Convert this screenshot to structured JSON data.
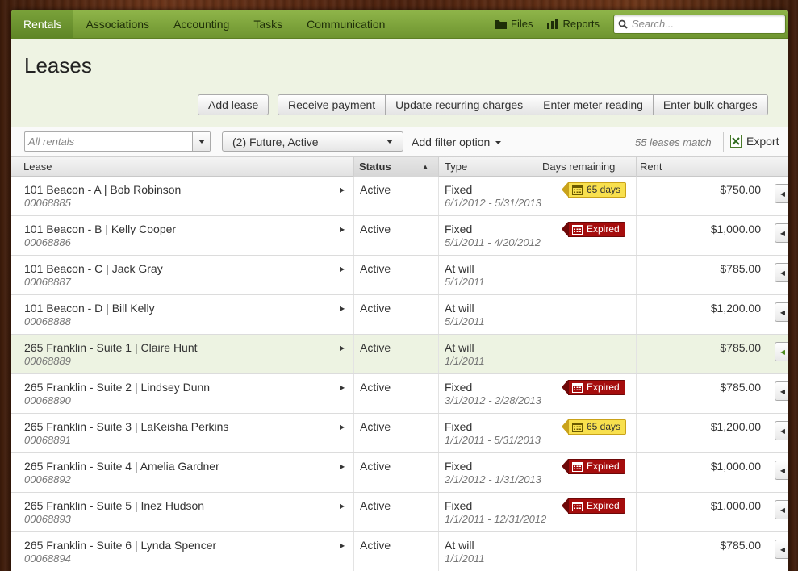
{
  "nav": {
    "items": [
      "Rentals",
      "Associations",
      "Accounting",
      "Tasks",
      "Communication"
    ],
    "files_label": "Files",
    "reports_label": "Reports",
    "search_placeholder": "Search..."
  },
  "page": {
    "title": "Leases",
    "add_lease": "Add lease",
    "actions": [
      "Receive payment",
      "Update recurring charges",
      "Enter meter reading",
      "Enter bulk charges"
    ]
  },
  "filters": {
    "rentals_placeholder": "All rentals",
    "status_selected": "(2) Future, Active",
    "add_filter": "Add filter option",
    "match_count": "55 leases match",
    "export": "Export"
  },
  "table": {
    "headers": [
      "Lease",
      "Status",
      "Type",
      "Days remaining",
      "Rent"
    ],
    "rows": [
      {
        "lease": "101 Beacon - A | Bob Robinson",
        "id": "00068885",
        "status": "Active",
        "type": "Fixed",
        "dates": "6/1/2012 - 5/31/2013",
        "badge": "65 days",
        "badge_type": "warn",
        "rent": "$750.00",
        "highlight": false
      },
      {
        "lease": "101 Beacon - B | Kelly Cooper",
        "id": "00068886",
        "status": "Active",
        "type": "Fixed",
        "dates": "5/1/2011 - 4/20/2012",
        "badge": "Expired",
        "badge_type": "exp",
        "rent": "$1,000.00",
        "highlight": false
      },
      {
        "lease": "101 Beacon - C | Jack Gray",
        "id": "00068887",
        "status": "Active",
        "type": "At will",
        "dates": "5/1/2011",
        "badge": "",
        "badge_type": "",
        "rent": "$785.00",
        "highlight": false
      },
      {
        "lease": "101 Beacon - D | Bill Kelly",
        "id": "00068888",
        "status": "Active",
        "type": "At will",
        "dates": "5/1/2011",
        "badge": "",
        "badge_type": "",
        "rent": "$1,200.00",
        "highlight": false
      },
      {
        "lease": "265 Franklin - Suite 1 | Claire Hunt",
        "id": "00068889",
        "status": "Active",
        "type": "At will",
        "dates": "1/1/2011",
        "badge": "",
        "badge_type": "",
        "rent": "$785.00",
        "highlight": true
      },
      {
        "lease": "265 Franklin - Suite 2 | Lindsey Dunn",
        "id": "00068890",
        "status": "Active",
        "type": "Fixed",
        "dates": "3/1/2012 - 2/28/2013",
        "badge": "Expired",
        "badge_type": "exp",
        "rent": "$785.00",
        "highlight": false
      },
      {
        "lease": "265 Franklin - Suite 3 | LaKeisha Perkins",
        "id": "00068891",
        "status": "Active",
        "type": "Fixed",
        "dates": "1/1/2011 - 5/31/2013",
        "badge": "65 days",
        "badge_type": "warn",
        "rent": "$1,200.00",
        "highlight": false
      },
      {
        "lease": "265 Franklin - Suite 4 | Amelia Gardner",
        "id": "00068892",
        "status": "Active",
        "type": "Fixed",
        "dates": "2/1/2012 - 1/31/2013",
        "badge": "Expired",
        "badge_type": "exp",
        "rent": "$1,000.00",
        "highlight": false
      },
      {
        "lease": "265 Franklin - Suite 5 | Inez Hudson",
        "id": "00068893",
        "status": "Active",
        "type": "Fixed",
        "dates": "1/1/2011 - 12/31/2012",
        "badge": "Expired",
        "badge_type": "exp",
        "rent": "$1,000.00",
        "highlight": false
      },
      {
        "lease": "265 Franklin - Suite 6 | Lynda Spencer",
        "id": "00068894",
        "status": "Active",
        "type": "At will",
        "dates": "1/1/2011",
        "badge": "",
        "badge_type": "",
        "rent": "$785.00",
        "highlight": false
      }
    ]
  },
  "colors": {
    "nav_green": "#7aa23a",
    "header_bg": "#eef3e3",
    "warn_badge": "#f8e04e",
    "expired_badge": "#a50d0d",
    "highlight_row": "#edf3e2"
  },
  "icons": {
    "files": "folder-icon",
    "reports": "bar-chart-icon",
    "search": "search-icon",
    "export": "excel-icon",
    "calendar": "calendar-icon"
  }
}
